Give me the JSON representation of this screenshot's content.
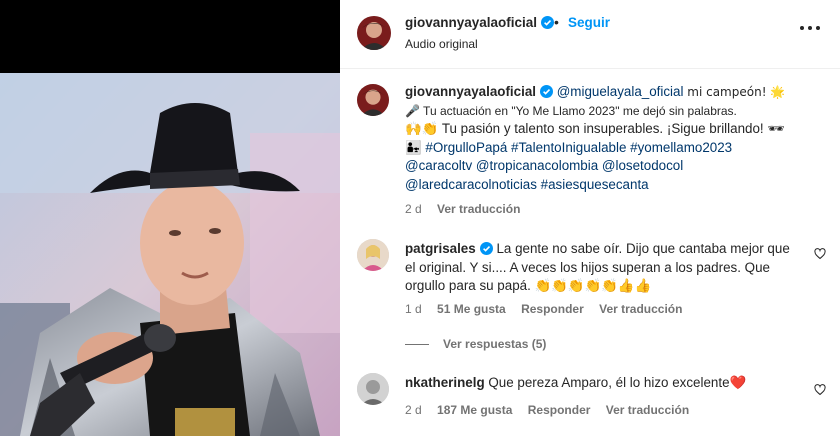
{
  "post": {
    "username": "giovannyayalaoficial",
    "separator": "•",
    "follow_label": "Seguir",
    "audio": "Audio original",
    "more_icon": "more-options-icon"
  },
  "caption": {
    "username": "giovannyayalaoficial",
    "mention": "@miguelayala_oficial",
    "text1": " mi campeón! 🌟",
    "text2": "🎤 Tu actuación en \"Yo Me Llamo 2023\" me dejó sin palabras.",
    "text3": "🙌👏 Tu pasión y talento son insuperables. ¡Sigue brillando! 🕶",
    "hashtags": "👨‍👧 #OrgulloPapá #TalentoInigualable #yomellamo2023",
    "mentions1": "@caracoltv @tropicanacolombia @losetodocol",
    "mentions2": "@laredcaracolnoticias #asiesquesecanta",
    "time": "2 d",
    "translate": "Ver traducción"
  },
  "comments": [
    {
      "username": "patgrisales",
      "text": "La gente no sabe oír. Dijo que cantaba mejor que el original. Y si.... A veces los hijos superan a los padres. Que orgullo para su papá. 👏👏👏👏👏👍👍",
      "time": "1 d",
      "likes": "51 Me gusta",
      "reply": "Responder",
      "translate": "Ver traducción"
    },
    {
      "username": "nkatherinelg",
      "text": "Que pereza Amparo, él lo hizo excelente❤️",
      "time": "2 d",
      "likes": "187 Me gusta",
      "reply": "Responder",
      "translate": "Ver traducción"
    }
  ],
  "replies_label": "Ver respuestas (5)",
  "colors": {
    "link": "#00376b",
    "follow": "#0095f6",
    "verified": "#0095f6",
    "muted": "#737373"
  }
}
